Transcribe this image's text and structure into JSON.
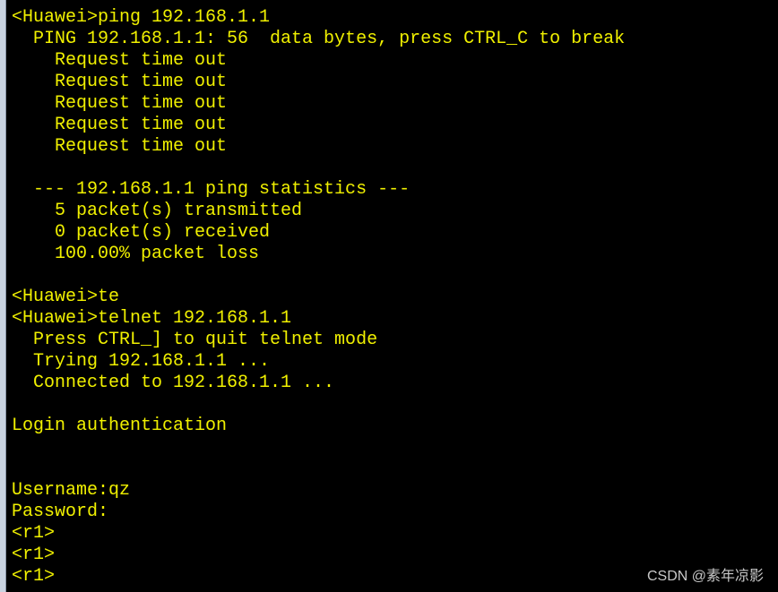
{
  "terminal": {
    "lines": [
      "<Huawei>",
      "<Huawei>ping 192.168.1.1",
      "  PING 192.168.1.1: 56  data bytes, press CTRL_C to break",
      "    Request time out",
      "    Request time out",
      "    Request time out",
      "    Request time out",
      "    Request time out",
      "",
      "  --- 192.168.1.1 ping statistics ---",
      "    5 packet(s) transmitted",
      "    0 packet(s) received",
      "    100.00% packet loss",
      "",
      "<Huawei>te",
      "<Huawei>telnet 192.168.1.1",
      "  Press CTRL_] to quit telnet mode",
      "  Trying 192.168.1.1 ...",
      "  Connected to 192.168.1.1 ...",
      "",
      "Login authentication",
      "",
      "",
      "Username:qz",
      "Password:",
      "<r1>",
      "<r1>",
      "<r1>"
    ]
  },
  "watermark": "CSDN @素年凉影",
  "colors": {
    "text": "#f0f000",
    "background": "#000000"
  }
}
